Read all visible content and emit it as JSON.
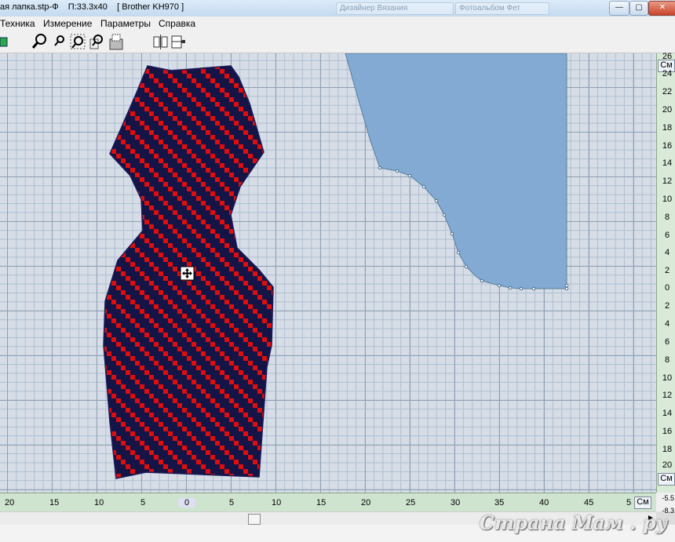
{
  "window": {
    "title_file": "ая лапка.stp-Ф",
    "title_size": "П:33.3х40",
    "title_machine": "[ Brother KH970 ]",
    "background_tabs": [
      "Дизайнер Вязания",
      "Фотоальбом Фет"
    ],
    "buttons": {
      "minimize": "—",
      "maximize": "▢",
      "close": "✕"
    }
  },
  "menu": [
    "Техника",
    "Измерение",
    "Параметры",
    "Справка"
  ],
  "toolbar": {
    "icons": [
      "palette-icon",
      "zoom-in-icon",
      "zoom-out-icon",
      "zoom-window-icon",
      "zoom-fit-icon",
      "zoom-actual-icon",
      "mirror-icon",
      "split-icon"
    ]
  },
  "canvas": {
    "cursor_icon": "move-cursor-icon",
    "colors": {
      "pattern_red": "#e00d0d",
      "pattern_navy": "#141447",
      "pattern_outline": "#1a1a5a",
      "piece_fill": "#82aad2",
      "piece_outline": "#5a7e9e",
      "grid_major": "#90a0b4",
      "grid_minor": "#aebfd2",
      "grid_bg": "#d6dde6"
    }
  },
  "vertical_ruler": {
    "ticks": [
      "26",
      "24",
      "22",
      "20",
      "18",
      "16",
      "14",
      "12",
      "10",
      "8",
      "6",
      "4",
      "2",
      "0",
      "2",
      "4",
      "6",
      "8",
      "10",
      "12",
      "14",
      "16",
      "18",
      "20"
    ],
    "unit_top": "См",
    "unit_bottom": "См"
  },
  "horizontal_ruler": {
    "ticks": [
      "20",
      "15",
      "10",
      "5",
      "0",
      "5",
      "10",
      "15",
      "20",
      "25",
      "30",
      "35",
      "40",
      "45",
      "5"
    ],
    "unit": "См"
  },
  "coords": {
    "x": "-5.5",
    "y": "-8.3"
  },
  "watermark": "Страна Мам . ру"
}
